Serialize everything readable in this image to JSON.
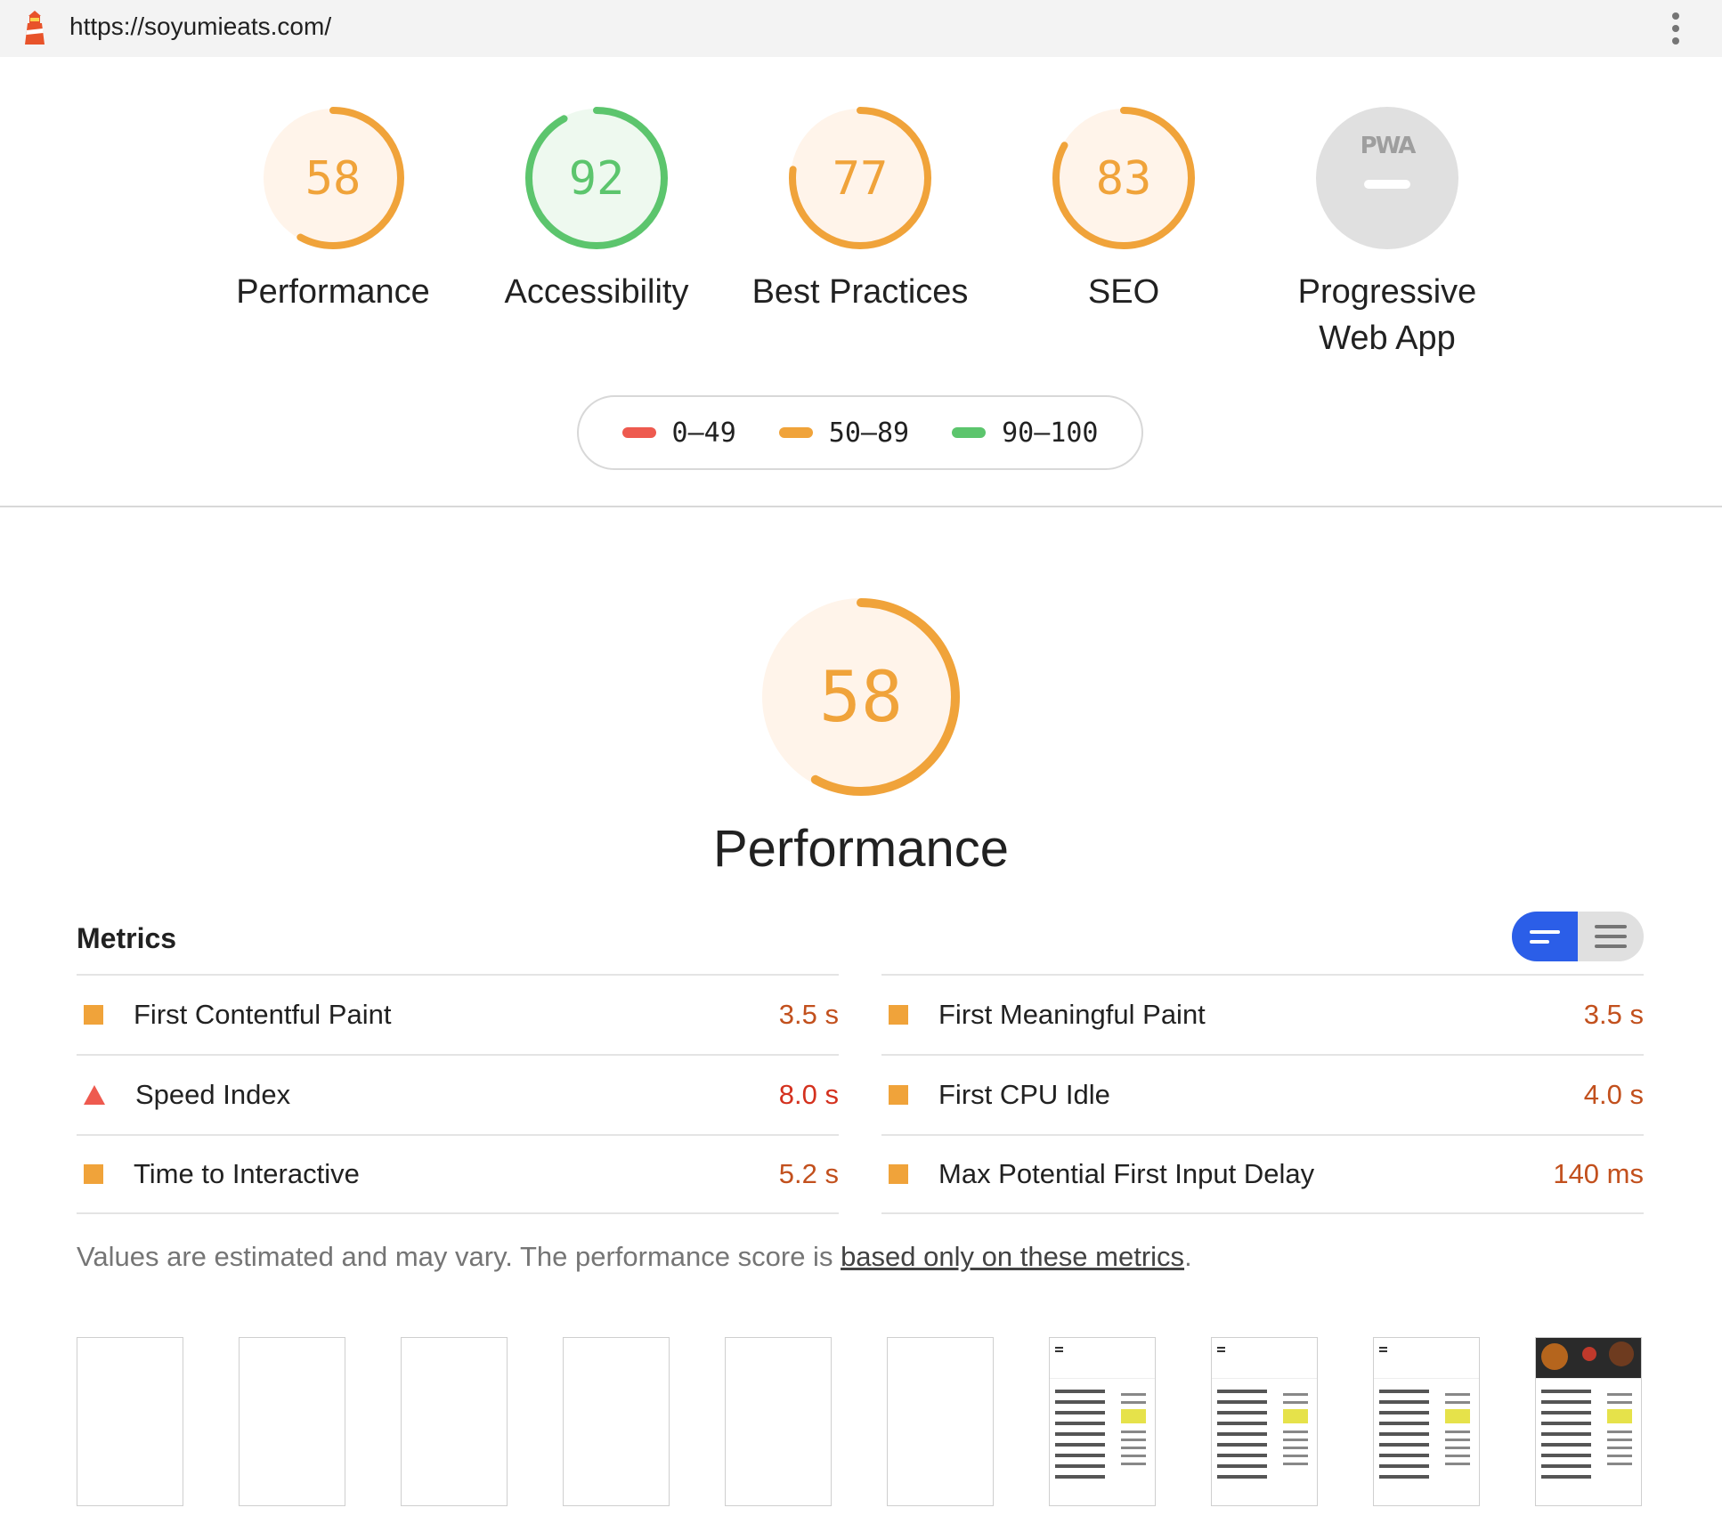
{
  "topbar": {
    "url": "https://soyumieats.com/",
    "logo_icon": "lighthouse-icon",
    "menu_icon": "kebab-menu-icon"
  },
  "gauges": [
    {
      "name": "performance",
      "value": "58",
      "label": "Performance",
      "score": 0.58,
      "color": "#f0a33a",
      "bg": "#fff4ea"
    },
    {
      "name": "accessibility",
      "value": "92",
      "label": "Accessibility",
      "score": 0.92,
      "color": "#5cc56d",
      "bg": "#eef9ef"
    },
    {
      "name": "best-practices",
      "value": "77",
      "label": "Best Practices",
      "score": 0.77,
      "color": "#f0a33a",
      "bg": "#fff4ea"
    },
    {
      "name": "seo",
      "value": "83",
      "label": "SEO",
      "score": 0.83,
      "color": "#f0a33a",
      "bg": "#fff4ea"
    },
    {
      "name": "pwa",
      "value": "PWA",
      "label": "Progressive Web App",
      "label_line1": "Progressive",
      "label_line2": "Web App",
      "color": "#9e9e9e",
      "bg": "#e0e0e0"
    }
  ],
  "legend": [
    {
      "range": "0–49",
      "color": "#ee5a4f"
    },
    {
      "range": "50–89",
      "color": "#f0a33a"
    },
    {
      "range": "90–100",
      "color": "#5cc56d"
    }
  ],
  "performance": {
    "score": "58",
    "score_fraction": 0.58,
    "title": "Performance",
    "color": "#f0a33a",
    "bg": "#fff4ea"
  },
  "metrics": {
    "title": "Metrics",
    "toggle": {
      "icons": [
        "compact-view-icon",
        "expanded-view-icon"
      ],
      "active_color": "#2b5ee8"
    },
    "left": [
      {
        "name": "First Contentful Paint",
        "value": "3.5 s",
        "status": "average"
      },
      {
        "name": "Speed Index",
        "value": "8.0 s",
        "status": "fail"
      },
      {
        "name": "Time to Interactive",
        "value": "5.2 s",
        "status": "average"
      }
    ],
    "right": [
      {
        "name": "First Meaningful Paint",
        "value": "3.5 s",
        "status": "average"
      },
      {
        "name": "First CPU Idle",
        "value": "4.0 s",
        "status": "average"
      },
      {
        "name": "Max Potential First Input Delay",
        "value": "140 ms",
        "status": "average"
      }
    ]
  },
  "note": {
    "prefix": "Values are estimated and may vary. The performance score is ",
    "link": "based only on these metrics",
    "suffix": "."
  },
  "filmstrip": {
    "frames": [
      "blank",
      "blank",
      "blank",
      "blank",
      "blank",
      "blank",
      "content",
      "content",
      "content",
      "hero"
    ]
  }
}
